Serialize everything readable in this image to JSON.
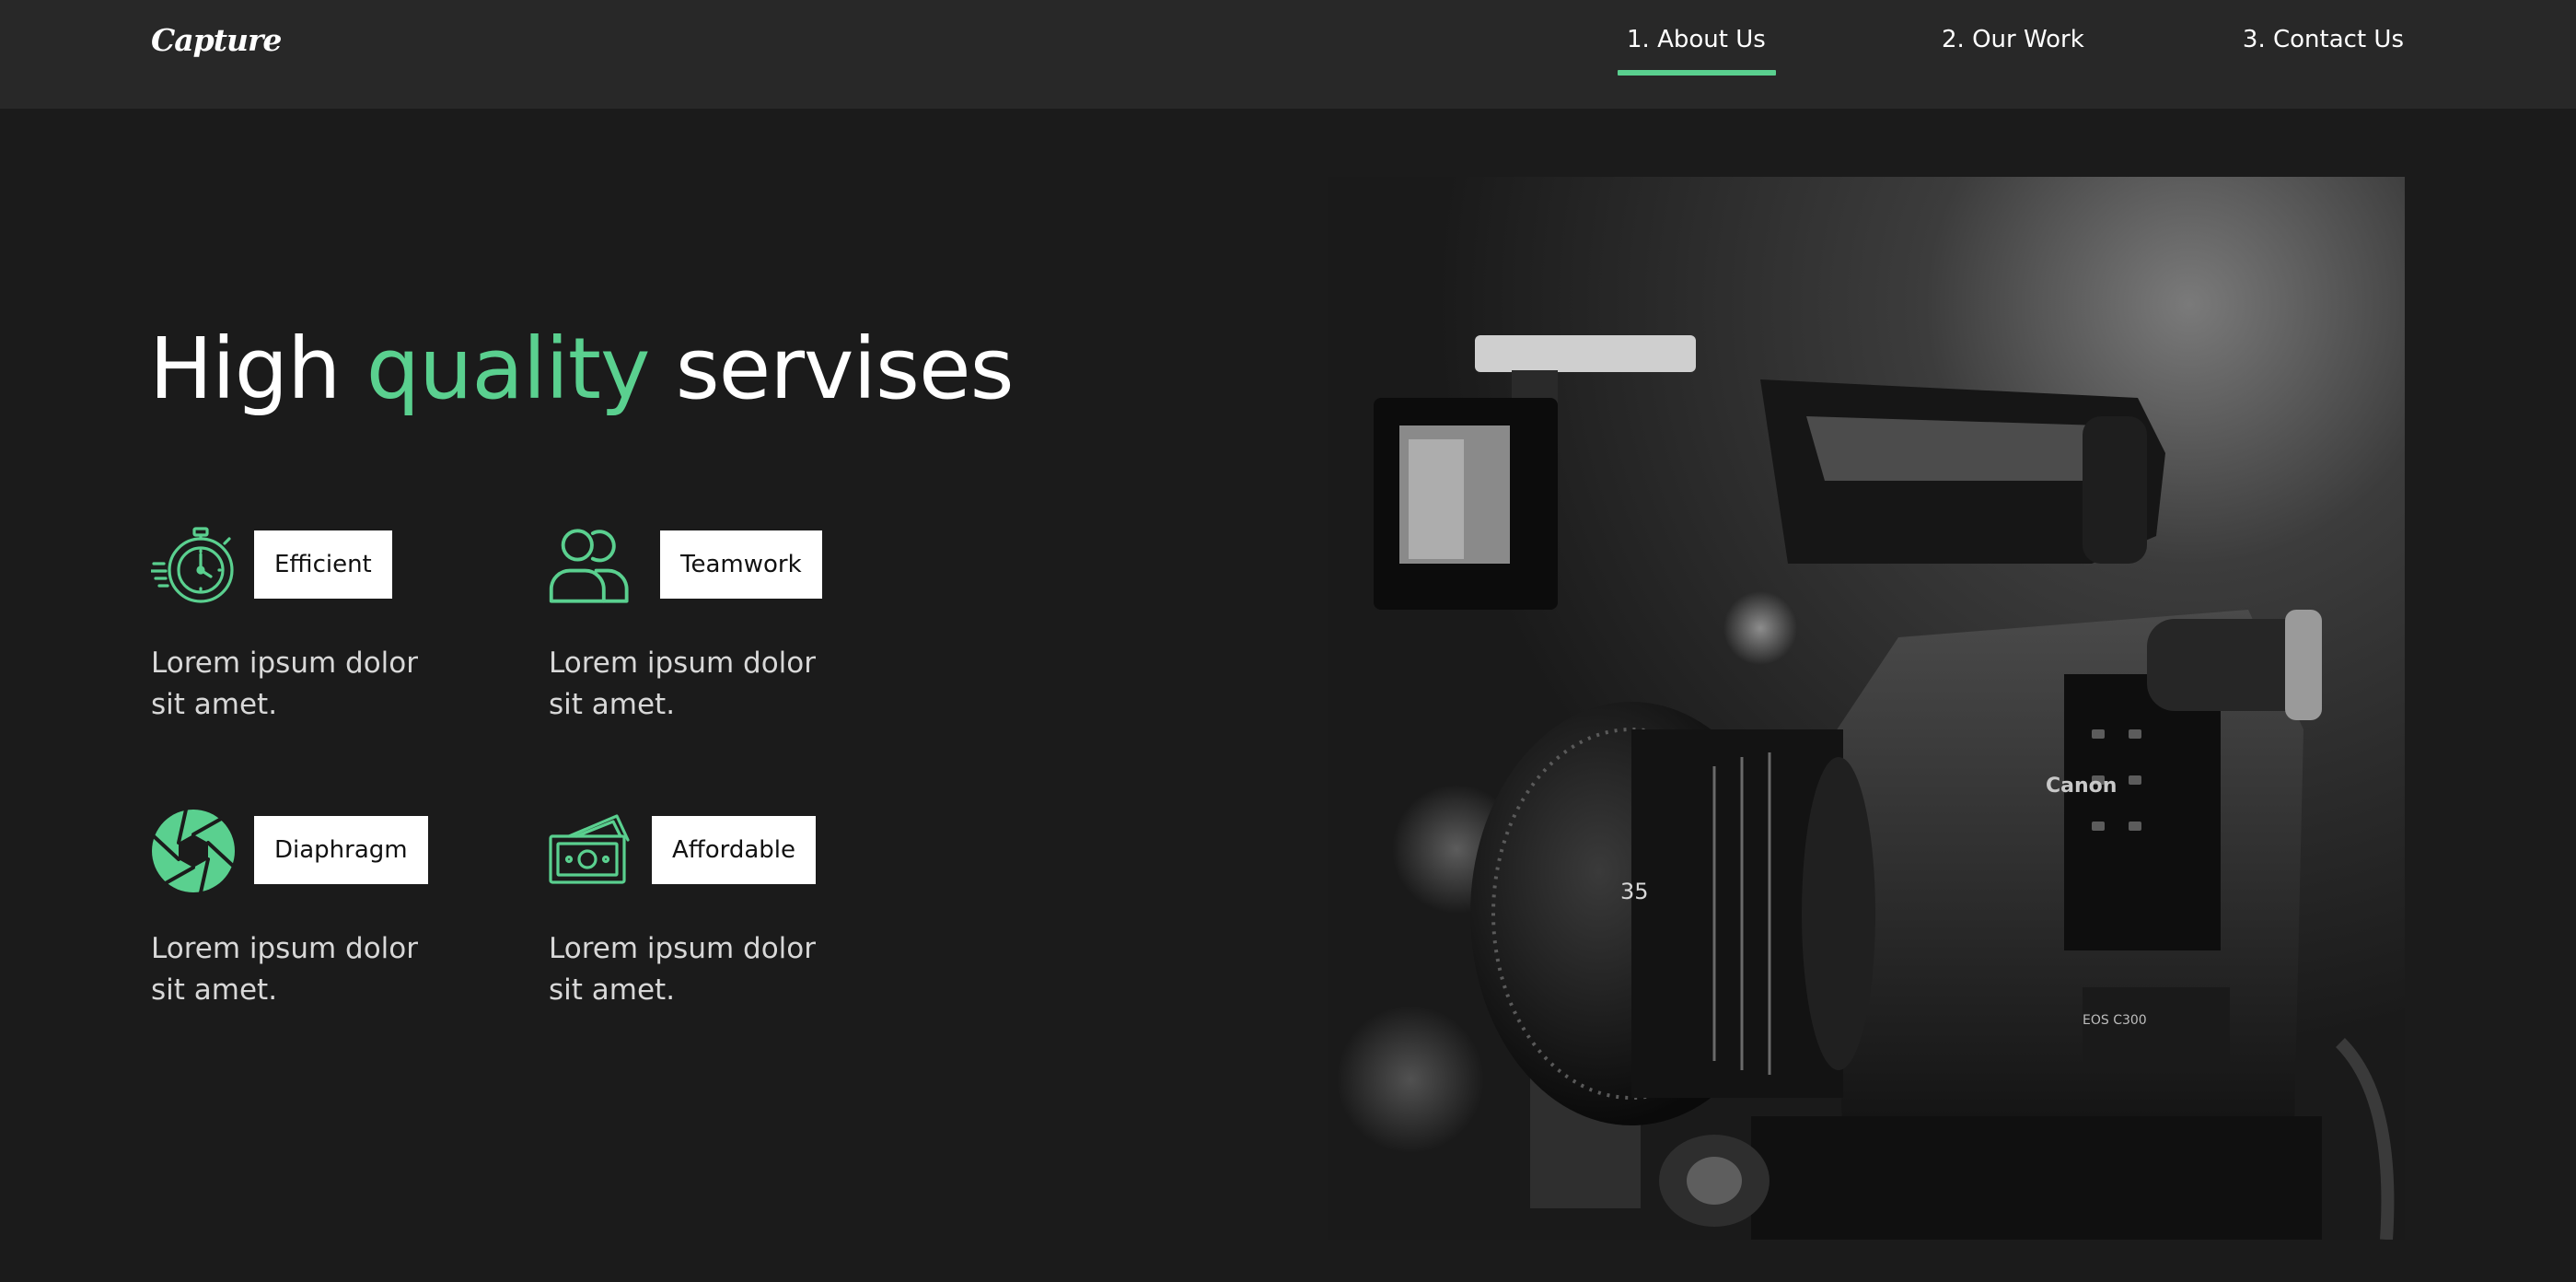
{
  "nav": {
    "logo": "Capture",
    "links": [
      {
        "label": "1. About Us",
        "active": true
      },
      {
        "label": "2. Our Work",
        "active": false
      },
      {
        "label": "3. Contact Us",
        "active": false
      }
    ]
  },
  "hero": {
    "headline_prefix": "High",
    "headline_accent": "quality",
    "headline_suffix": "servises",
    "accent_color": "#5ad08f"
  },
  "features": [
    {
      "icon": "stopwatch-icon",
      "title": "Efficient",
      "description": "Lorem ipsum dolor sit amet."
    },
    {
      "icon": "teamwork-icon",
      "title": "Teamwork",
      "description": "Lorem ipsum dolor sit amet."
    },
    {
      "icon": "diaphragm-icon",
      "title": "Diaphragm",
      "description": "Lorem ipsum dolor sit amet."
    },
    {
      "icon": "money-icon",
      "title": "Affordable",
      "description": "Lorem ipsum dolor sit amet."
    }
  ],
  "image": {
    "subject": "camera-photo",
    "lens_marking": "35",
    "brand_marking": "Canon",
    "model_marking": "EOS C300"
  }
}
